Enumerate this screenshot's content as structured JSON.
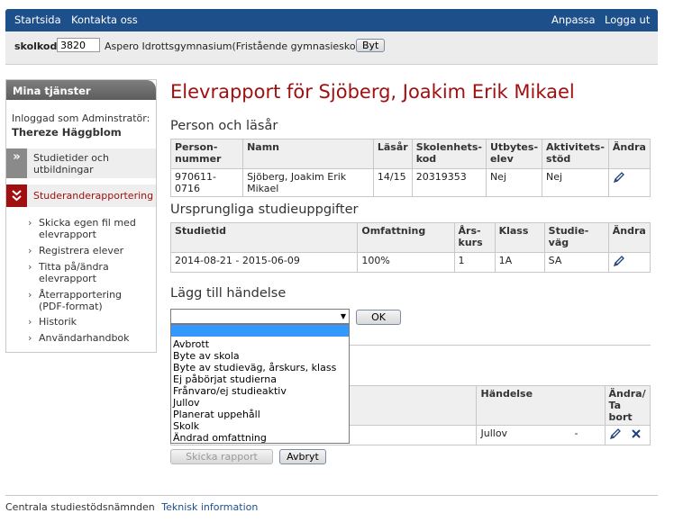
{
  "topbar": {
    "home": "Startsida",
    "contact": "Kontakta oss",
    "customize": "Anpassa",
    "logout": "Logga ut"
  },
  "schoolbar": {
    "label": "skolkod:",
    "code": "3820",
    "school": "Aspero Idrottsgymnasium(Fristående gymnasieskola)",
    "change_button": "Byt"
  },
  "sidebar": {
    "title": "Mina tjänster",
    "logged_in_label": "Inloggad som Adminstratör:",
    "user": "Thereze Häggblom",
    "items": [
      {
        "label": "Studietider och utbildningar",
        "icon": ">>"
      },
      {
        "label": "Studeranderapportering",
        "icon": "chevron-double-down"
      }
    ],
    "subitems": [
      "Skicka egen fil med elevrapport",
      "Registrera elever",
      "Titta på/ändra elevrapport",
      "Återrapportering (PDF-format)",
      "Historik",
      "Användarhandbok"
    ]
  },
  "main": {
    "title": "Elevrapport för Sjöberg, Joakim Erik Mikael",
    "section1": {
      "heading": "Person och läsår",
      "headers": [
        "Person-nummer",
        "Namn",
        "Läsår",
        "Skolenhets-kod",
        "Utbytes-elev",
        "Aktivitets-stöd",
        "Ändra"
      ],
      "row": [
        "970611-0716",
        "Sjöberg, Joakim Erik Mikael",
        "14/15",
        "20319353",
        "Nej",
        "Nej"
      ]
    },
    "section2": {
      "heading": "Ursprungliga studieuppgifter",
      "headers": [
        "Studietid",
        "Omfattning",
        "Års-kurs",
        "Klass",
        "Studie-väg",
        "Ändra"
      ],
      "row": [
        "2014-08-21 - 2015-06-09",
        "100%",
        "1",
        "1A",
        "SA"
      ]
    },
    "section3": {
      "heading": "Lägg till händelse",
      "select_value": "",
      "ok_button": "OK",
      "options": [
        "Avbrott",
        "Byte av skola",
        "Byte av studieväg, årskurs, klass",
        "Ej påbörjat studierna",
        "Frånvaro/ej studieaktiv",
        "Jullov",
        "Planerat uppehåll",
        "Skolk",
        "Ändrad omfattning"
      ]
    },
    "events": {
      "headers": [
        "Händelse",
        "Ändra/ Ta bort"
      ],
      "row": [
        "Jullov",
        "-"
      ]
    },
    "send_button": "Skicka rapport",
    "cancel_button": "Avbryt"
  },
  "footer": {
    "org": "Centrala studiestödsnämnden",
    "link": "Teknisk information"
  }
}
